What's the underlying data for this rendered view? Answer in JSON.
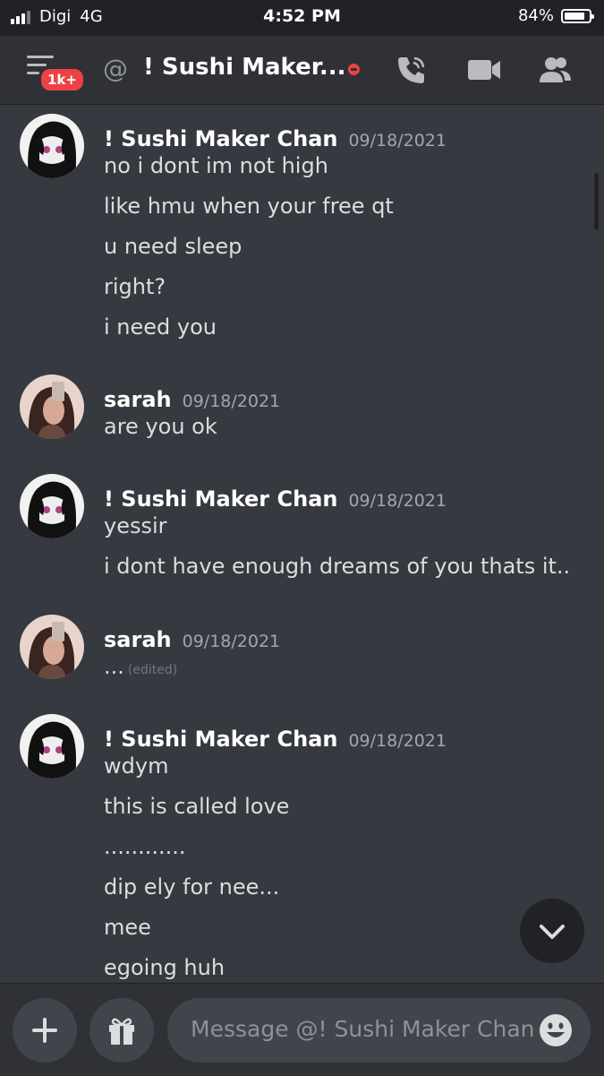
{
  "status_bar": {
    "carrier": "Digi",
    "network": "4G",
    "time": "4:52 PM",
    "battery": "84%",
    "battery_level": 0.84
  },
  "header": {
    "badge": "1k+",
    "at_symbol": "@",
    "title": "! Sushi Maker...",
    "status": "do-not-disturb",
    "icons": [
      "menu-icon",
      "phone-call-icon",
      "video-call-icon",
      "members-icon"
    ]
  },
  "messages": [
    {
      "author": "! Sushi Maker Chan",
      "timestamp": "09/18/2021",
      "avatar": "anime-avatar",
      "lines": [
        "no i dont im not high",
        "like hmu when your free qt",
        "u need sleep",
        "right?",
        "i need you"
      ]
    },
    {
      "author": "sarah",
      "timestamp": "09/18/2021",
      "avatar": "selfie-avatar",
      "lines": [
        "are you ok"
      ]
    },
    {
      "author": "! Sushi Maker Chan",
      "timestamp": "09/18/2021",
      "avatar": "anime-avatar",
      "lines": [
        "yessir",
        "i dont have enough dreams of you thats it.."
      ]
    },
    {
      "author": "sarah",
      "timestamp": "09/18/2021",
      "avatar": "selfie-avatar",
      "lines": [
        "..."
      ],
      "edited_label": "(edited)"
    },
    {
      "author": "! Sushi Maker Chan",
      "timestamp": "09/18/2021",
      "avatar": "anime-avatar",
      "lines": [
        "wdym",
        "this is called love",
        "............",
        "dip ely for nee...",
        "mee",
        "egoing huh"
      ]
    }
  ],
  "composer": {
    "placeholder": "Message @! Sushi Maker Chan",
    "icons": [
      "plus-icon",
      "gift-icon",
      "emoji-icon"
    ]
  },
  "colors": {
    "background": "#36393f",
    "header": "#2f3136",
    "input": "#40444b",
    "badge": "#ed4245"
  }
}
